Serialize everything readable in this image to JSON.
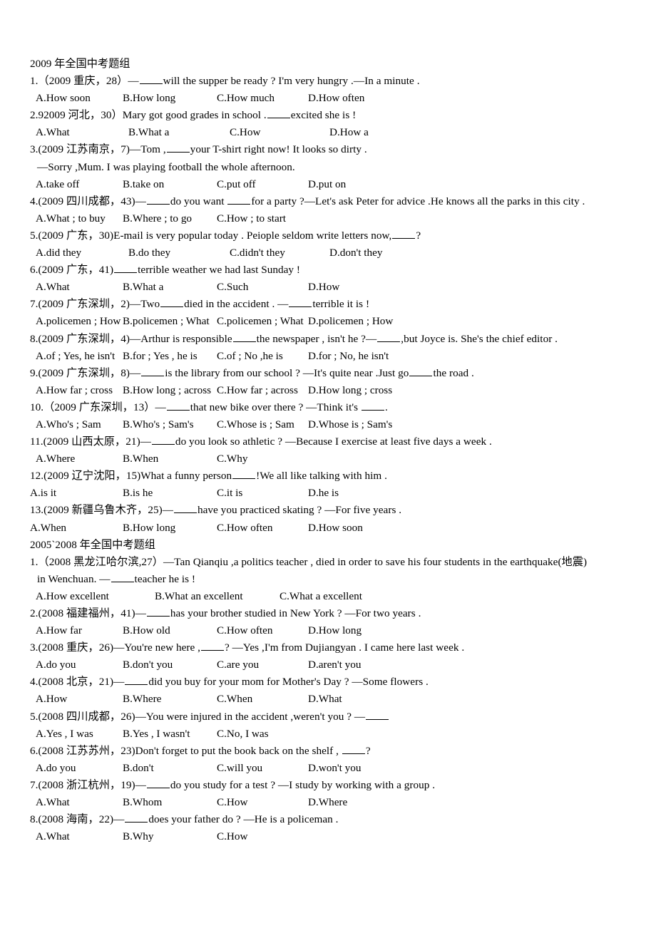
{
  "document": {
    "sections": [
      {
        "heading": "2009 年全国中考题组",
        "questions": [
          {
            "stem_parts": [
              "1.（2009 重庆，28）—",
              "BLANK",
              "will the supper be ready ? I'm very hungry .—In a minute ."
            ],
            "options": [
              "A.How soon",
              "B.How long",
              "C.How much",
              "D.How often"
            ],
            "opt_layout": "normal"
          },
          {
            "stem_parts": [
              "2.92009 河北，30）Mary got good grades in school .",
              "BLANK",
              "excited she is !"
            ],
            "options": [
              "A.What",
              "B.What a",
              "C.How",
              "D.How a"
            ],
            "opt_layout": "narrow"
          },
          {
            "stem_parts": [
              "3.(2009 江苏南京，7)—Tom ,",
              "BLANK",
              "your T-shirt right now! It looks so dirty ."
            ],
            "continuation": "—Sorry ,Mum. I was playing football the whole afternoon.",
            "options": [
              "A.take off",
              "B.take on",
              "C.put off",
              "D.put on"
            ],
            "opt_layout": "normal"
          },
          {
            "stem_parts": [
              "4.(2009 四川成都，43)—",
              "BLANK",
              "do you want ",
              "BLANK",
              "for a party ?—Let's ask Peter for advice .He knows all the parks in this city ."
            ],
            "options": [
              "A.What ; to buy",
              "B.Where ; to go",
              "C.How ; to start"
            ],
            "opt_layout": "normal"
          },
          {
            "stem_parts": [
              "5.(2009 广东，30)E-mail is very popular today . Peiople seldom write letters now,",
              "BLANK",
              "?"
            ],
            "options": [
              "A.did they",
              "B.do they",
              "C.didn't they",
              "D.don't they"
            ],
            "opt_layout": "narrow"
          },
          {
            "stem_parts": [
              "6.(2009 广东，41)",
              "BLANK",
              "terrible weather we had last Sunday !"
            ],
            "options": [
              "A.What",
              "B.What a",
              "C.Such",
              "D.How"
            ],
            "opt_layout": "normal"
          },
          {
            "stem_parts": [
              "7.(2009 广东深圳，2)—Two",
              "BLANK",
              "died in the accident . —",
              "BLANK",
              "terrible it is !"
            ],
            "options": [
              "A.policemen ; How",
              "B.policemen ; What",
              "C.policemen ; What",
              "D.policemen ; How"
            ],
            "opt_layout": "normal"
          },
          {
            "stem_parts": [
              "8.(2009 广东深圳，4)—Arthur is responsible",
              "BLANK",
              "the newspaper , isn't he ?—",
              "BLANK",
              ",but Joyce is. She's the chief editor ."
            ],
            "options": [
              "A.of ; Yes, he isn't",
              "B.for ; Yes , he is",
              "C.of ; No ,he is",
              "D.for ; No, he isn't"
            ],
            "opt_layout": "normal"
          },
          {
            "stem_parts": [
              "9.(2009 广东深圳，8)—",
              "BLANK",
              "is the library from our school ? —It's quite near .Just go",
              "BLANK",
              "the road ."
            ],
            "options": [
              "A.How far ; cross",
              "B.How long ; across",
              "C.How far ; across",
              "D.How long ; cross"
            ],
            "opt_layout": "normal"
          },
          {
            "stem_parts": [
              "10.（2009 广东深圳，13）—",
              "BLANK",
              "that new bike over there ? —Think it's ",
              "BLANK",
              "."
            ],
            "options": [
              "A.Who's ; Sam",
              "B.Who's ; Sam's",
              "C.Whose is ; Sam",
              "D.Whose is ; Sam's"
            ],
            "opt_layout": "normal"
          },
          {
            "stem_parts": [
              "11.(2009 山西太原，21)—",
              "BLANK",
              "do you look so athletic ? —Because I exercise at least five days a week ."
            ],
            "options": [
              "A.Where",
              "B.When",
              "C.Why"
            ],
            "opt_layout": "normal"
          },
          {
            "stem_parts": [
              "12.(2009 辽宁沈阳，15)What a funny person",
              "BLANK",
              "!We all like talking with him ."
            ],
            "options": [
              "A.is it",
              "B.is he",
              "C.it is",
              "D.he is"
            ],
            "opt_layout": "flush"
          },
          {
            "stem_parts": [
              "13.(2009 新疆乌鲁木齐，25)—",
              "BLANK",
              "have you practiced skating ? —For five years ."
            ],
            "options": [
              "A.When",
              "B.How long",
              "C.How often",
              "D.How soon"
            ],
            "opt_layout": "flush"
          }
        ]
      },
      {
        "heading": "2005`2008 年全国中考题组",
        "questions": [
          {
            "stem_parts": [
              "1.（2008 黑龙江哈尔滨,27）—Tan Qianqiu ,a politics teacher , died in order to save his four students in the earthquake(地震)"
            ],
            "continuation_parts": [
              "in Wenchuan. —",
              "BLANK",
              "teacher he is !"
            ],
            "options": [
              "A.How excellent",
              "B.What an excellent",
              "C.What a excellent"
            ],
            "opt_layout": "wide3"
          },
          {
            "stem_parts": [
              "2.(2008 福建福州，41)—",
              "BLANK",
              "has your brother studied in New York ? —For two years ."
            ],
            "options": [
              "A.How far",
              "B.How old",
              "C.How often",
              "D.How long"
            ],
            "opt_layout": "normal"
          },
          {
            "stem_parts": [
              "3.(2008 重庆，26)—You're new here ,",
              "BLANK",
              "? —Yes ,I'm from Dujiangyan . I came here last week ."
            ],
            "options": [
              "A.do you",
              "B.don't you",
              "C.are you",
              "D.aren't you"
            ],
            "opt_layout": "normal"
          },
          {
            "stem_parts": [
              "4.(2008 北京，21)—",
              "BLANK",
              "did you buy for your mom for Mother's Day ? —Some flowers ."
            ],
            "options": [
              "A.How",
              "B.Where",
              "C.When",
              "D.What"
            ],
            "opt_layout": "normal"
          },
          {
            "stem_parts": [
              "5.(2008 四川成都，26)—You were injured in the accident ,weren't you ?   —",
              "BLANK"
            ],
            "options": [
              "A.Yes , I was",
              "B.Yes , I wasn't",
              "C.No, I was"
            ],
            "opt_layout": "normal"
          },
          {
            "stem_parts": [
              "6.(2008 江苏苏州，23)Don't forget to put the book back on the shelf , ",
              "BLANK",
              "?"
            ],
            "options": [
              "A.do you",
              "B.don't",
              "C.will you",
              "D.won't you"
            ],
            "opt_layout": "normal"
          },
          {
            "stem_parts": [
              "7.(2008 浙江杭州，19)—",
              "BLANK",
              "do you study for a test ? —I study by working with a group ."
            ],
            "options": [
              "A.What",
              "B.Whom",
              "C.How",
              "D.Where"
            ],
            "opt_layout": "normal"
          },
          {
            "stem_parts": [
              "8.(2008 海南，22)—",
              "BLANK",
              "does your father do ?   —He is a policeman ."
            ],
            "options": [
              "A.What",
              "B.Why",
              "C.How"
            ],
            "opt_layout": "normal"
          }
        ]
      }
    ]
  }
}
